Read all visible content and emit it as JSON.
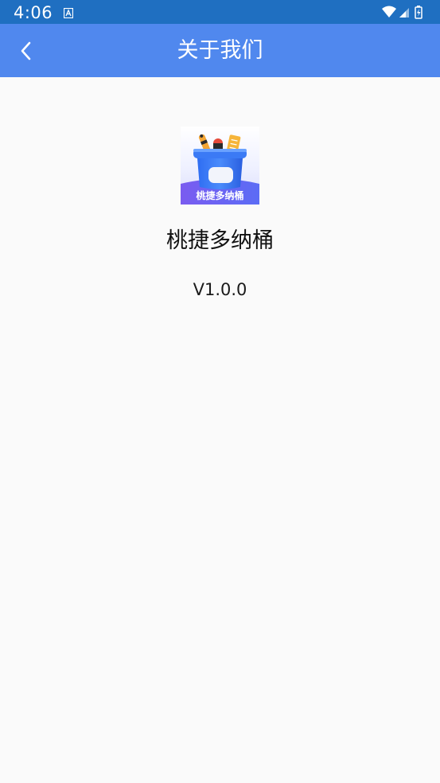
{
  "status_bar": {
    "time": "4:06",
    "notification_icon": "app-notification-icon",
    "wifi_icon": "wifi-icon",
    "signal_icon": "signal-icon",
    "battery_icon": "battery-charging-icon"
  },
  "app_bar": {
    "title": "关于我们",
    "back_icon": "chevron-left-icon",
    "background": "#5088ee"
  },
  "about": {
    "logo_text": "桃捷多纳桶",
    "app_name": "桃捷多纳桶",
    "version": "V1.0.0"
  },
  "colors": {
    "status_bar": "#1f6fc1",
    "app_bar": "#5088ee",
    "page_background": "#fafafa"
  }
}
